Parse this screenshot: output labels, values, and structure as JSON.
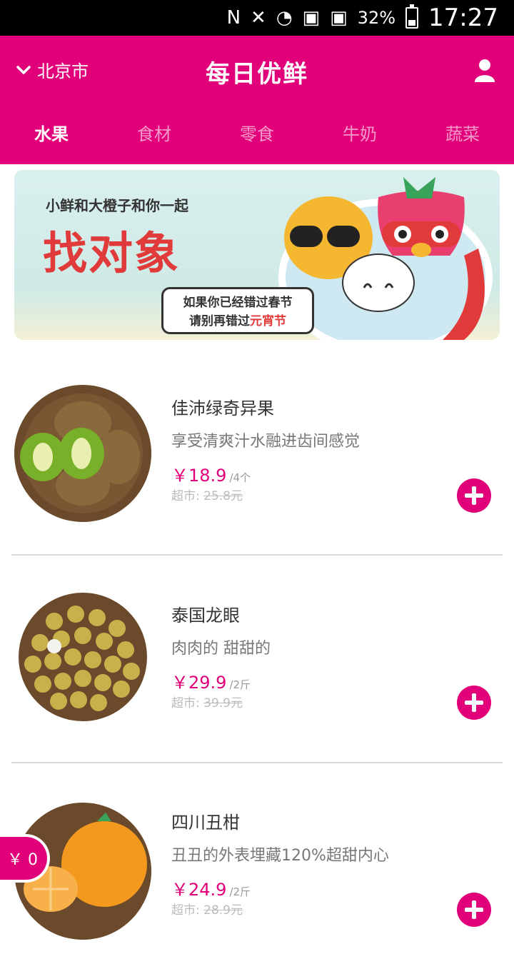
{
  "status_bar": {
    "battery": "32%",
    "time": "17:27"
  },
  "header": {
    "city": "北京市",
    "brand": "每日优鲜",
    "tabs": [
      "水果",
      "食材",
      "零食",
      "牛奶",
      "蔬菜"
    ]
  },
  "banner": {
    "subtitle": "小鲜和大橙子和你一起",
    "title": "找对象",
    "bubble_line1": "如果你已经错过春节",
    "bubble_line2_prefix": "请别再错过",
    "bubble_line2_highlight": "元宵节"
  },
  "products": [
    {
      "name": "佳沛绿奇异果",
      "desc": "享受清爽汁水融进齿间感觉",
      "price": "￥18.9",
      "unit": "/4个",
      "market_label": "超市:",
      "market_price": "25.8元"
    },
    {
      "name": "泰国龙眼",
      "desc": "肉肉的 甜甜的",
      "price": "￥29.9",
      "unit": "/2斤",
      "market_label": "超市:",
      "market_price": "39.9元"
    },
    {
      "name": "四川丑柑",
      "desc": "丑丑的外表埋藏120%超甜内心",
      "price": "￥24.9",
      "unit": "/2斤",
      "market_label": "超市:",
      "market_price": "28.9元"
    }
  ],
  "cart": {
    "amount": "￥ 0"
  },
  "colors": {
    "brand": "#e2007a"
  }
}
